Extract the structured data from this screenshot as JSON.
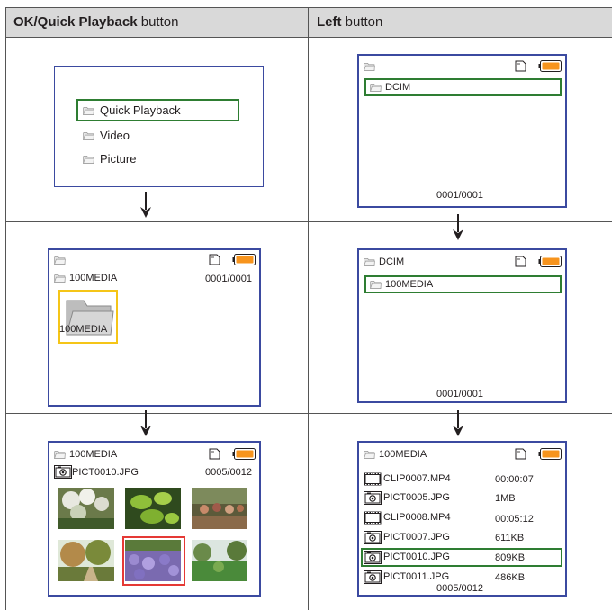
{
  "headers": {
    "left_bold": "OK/Quick Playback",
    "left_rest": " button",
    "right_bold": "Left",
    "right_rest": " button"
  },
  "menu": {
    "items": [
      "Quick Playback",
      "Video",
      "Picture"
    ]
  },
  "dcim_screen": {
    "folder": "DCIM",
    "counter": "0001/0001"
  },
  "media_screen": {
    "path": "100MEDIA",
    "counter": "0001/0001",
    "folder_label": "100MEDIA"
  },
  "dcim_screen2": {
    "path": "DCIM",
    "folder": "100MEDIA",
    "counter": "0001/0001"
  },
  "thumb_screen": {
    "path": "100MEDIA",
    "file": "PICT0010.JPG",
    "counter": "0005/0012",
    "thumbnails": [
      "white flowers",
      "lily pads",
      "people seated",
      "tree path",
      "purple flowers",
      "garden"
    ]
  },
  "list_screen": {
    "path": "100MEDIA",
    "counter": "0005/0012",
    "rows": [
      {
        "name": "CLIP0007.MP4",
        "info": "00:00:07",
        "icon": "film-icon"
      },
      {
        "name": "PICT0005.JPG",
        "info": "1MB",
        "icon": "camera-icon"
      },
      {
        "name": "CLIP0008.MP4",
        "info": "00:05:12",
        "icon": "film-icon"
      },
      {
        "name": "PICT0007.JPG",
        "info": "611KB",
        "icon": "camera-icon"
      },
      {
        "name": "PICT0010.JPG",
        "info": "809KB",
        "icon": "camera-icon"
      },
      {
        "name": "PICT0011.JPG",
        "info": "486KB",
        "icon": "camera-icon"
      }
    ]
  },
  "colors": {
    "screen_border": "#3b4aa0",
    "selection": "#2e7d32",
    "battery": "#f7941d",
    "thumb_highlight": "#e53935",
    "folder_highlight": "#f5c518"
  }
}
